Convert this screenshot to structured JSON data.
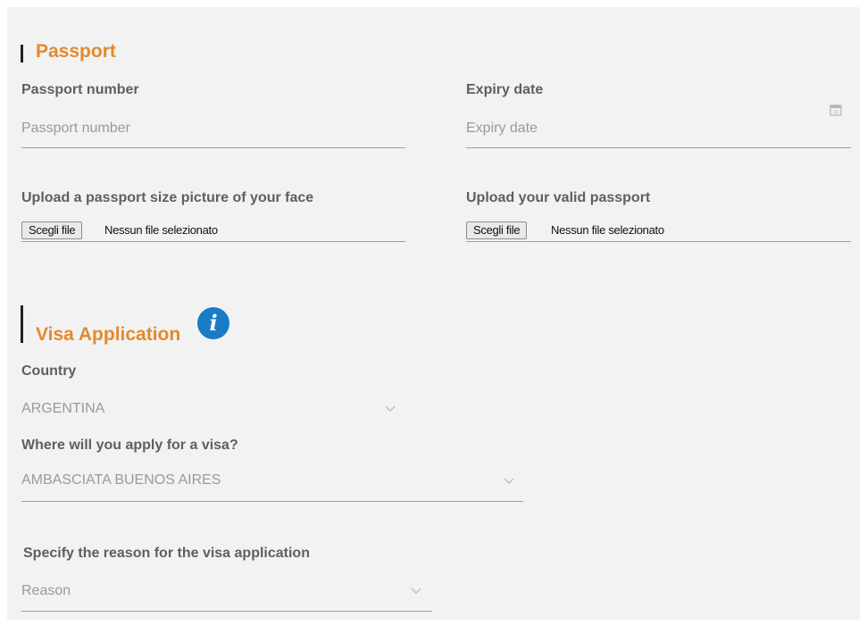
{
  "passport": {
    "title": "Passport",
    "number_label": "Passport number",
    "number_placeholder": "Passport number",
    "expiry_label": "Expiry date",
    "expiry_placeholder": "Expiry date",
    "calendar_icon": "calendar-icon",
    "photo_upload_label": "Upload a passport size picture of your face",
    "photo_button": "Scegli file",
    "photo_status": "Nessun file selezionato",
    "passport_upload_label": "Upload your valid passport",
    "passport_button": "Scegli file",
    "passport_status": "Nessun file selezionato"
  },
  "visa": {
    "title": "Visa Application",
    "info_icon": "info-icon",
    "info_glyph": "i",
    "country_label": "Country",
    "country_value": "ARGENTINA",
    "apply_label": "Where will you apply for a visa?",
    "apply_value": "AMBASCIATA BUENOS AIRES",
    "reason_label": "Specify the reason for the visa application",
    "reason_placeholder": "Reason"
  },
  "colors": {
    "accent": "#e38a2d",
    "info_blue": "#1a7cc6",
    "panel_bg": "#f2f2f2"
  }
}
